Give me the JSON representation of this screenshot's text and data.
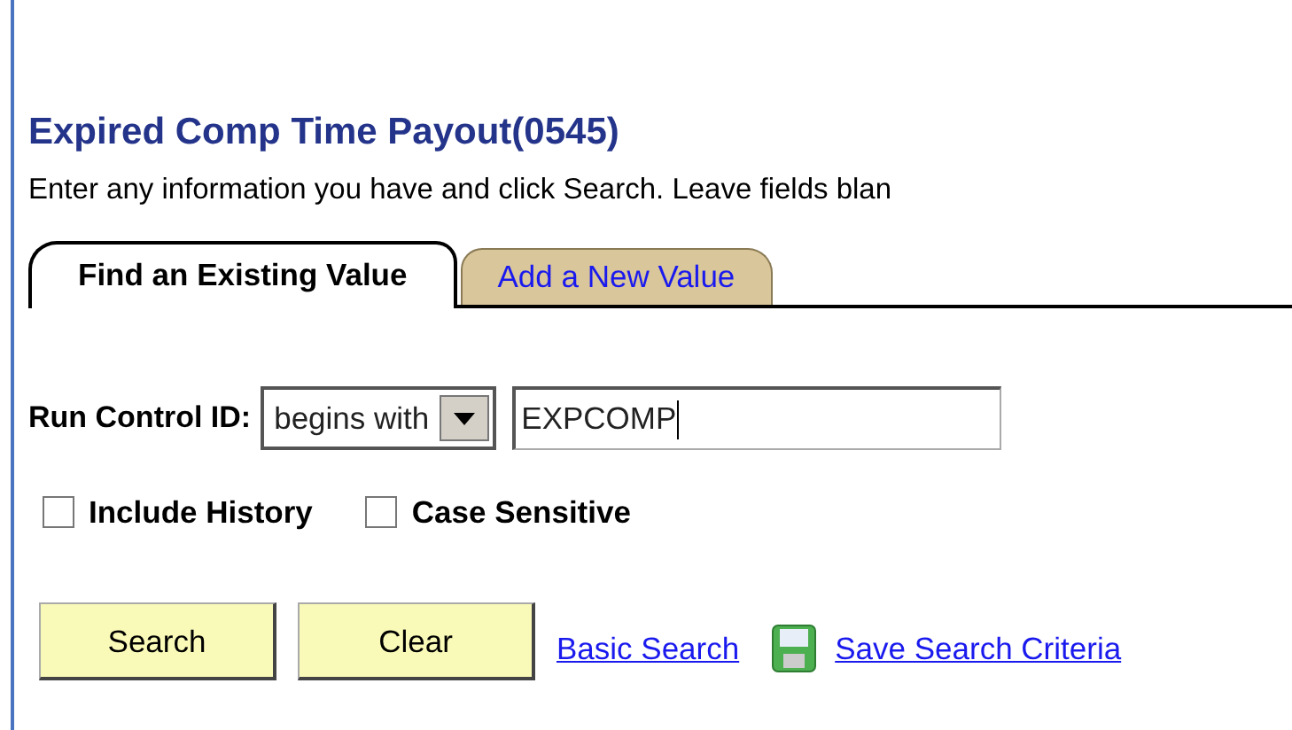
{
  "title": "Expired Comp Time Payout(0545)",
  "instructions": "Enter any information you have and click Search. Leave fields blan",
  "tabs": [
    {
      "label": "Find an Existing Value",
      "selected": true
    },
    {
      "label": "Add a New Value",
      "selected": false
    }
  ],
  "run_control": {
    "label": "Run Control ID:",
    "operator": "begins with",
    "value": "EXPCOMP"
  },
  "options": [
    {
      "label": "Include History",
      "checked": false
    },
    {
      "label": "Case Sensitive",
      "checked": false
    }
  ],
  "buttons": [
    "Search",
    "Clear"
  ],
  "links": [
    {
      "label": "Basic Search",
      "kind": "plain"
    },
    {
      "label": "Save Search Criteria",
      "kind": "save"
    }
  ]
}
